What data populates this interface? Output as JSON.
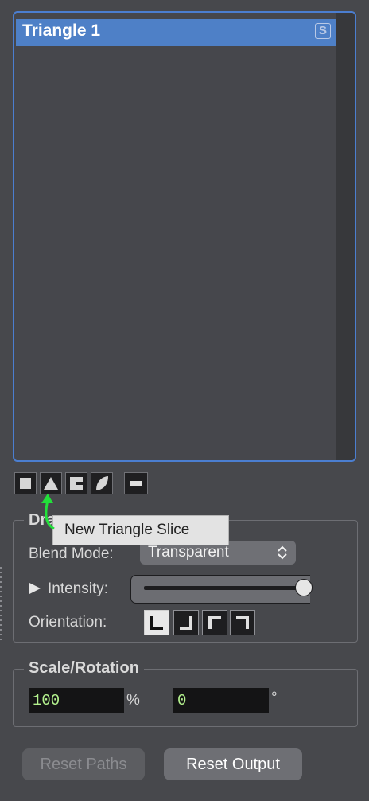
{
  "slice_list": {
    "items": [
      {
        "label": "Triangle 1",
        "solo_badge": "S",
        "selected": true
      }
    ]
  },
  "slice_buttons": [
    {
      "name": "new-quad-slice",
      "icon": "square-icon"
    },
    {
      "name": "new-triangle-slice",
      "icon": "triangle-icon"
    },
    {
      "name": "new-circle-slice",
      "icon": "bracket-icon"
    },
    {
      "name": "new-mask",
      "icon": "leaf-icon"
    },
    {
      "name": "remove-slice",
      "icon": "minus-icon"
    }
  ],
  "tooltip": "New Triangle Slice",
  "draw": {
    "legend_partial": "Dra",
    "blend_mode_label": "Blend Mode:",
    "blend_mode_value": "Transparent",
    "intensity_label": "Intensity:",
    "intensity_value": 1.0,
    "orientation_label": "Orientation:",
    "orientation_selected": 0
  },
  "scale_rotation": {
    "legend": "Scale/Rotation",
    "scale_value": "100",
    "scale_unit": "%",
    "rotation_value": "0",
    "rotation_unit": "°"
  },
  "buttons": {
    "reset_paths": "Reset Paths",
    "reset_output": "Reset Output"
  },
  "colors": {
    "selection": "#4e80c7",
    "focus_ring": "#4b7ed0",
    "field_text": "#b4f28e",
    "cursor_arrow": "#22e03a"
  }
}
